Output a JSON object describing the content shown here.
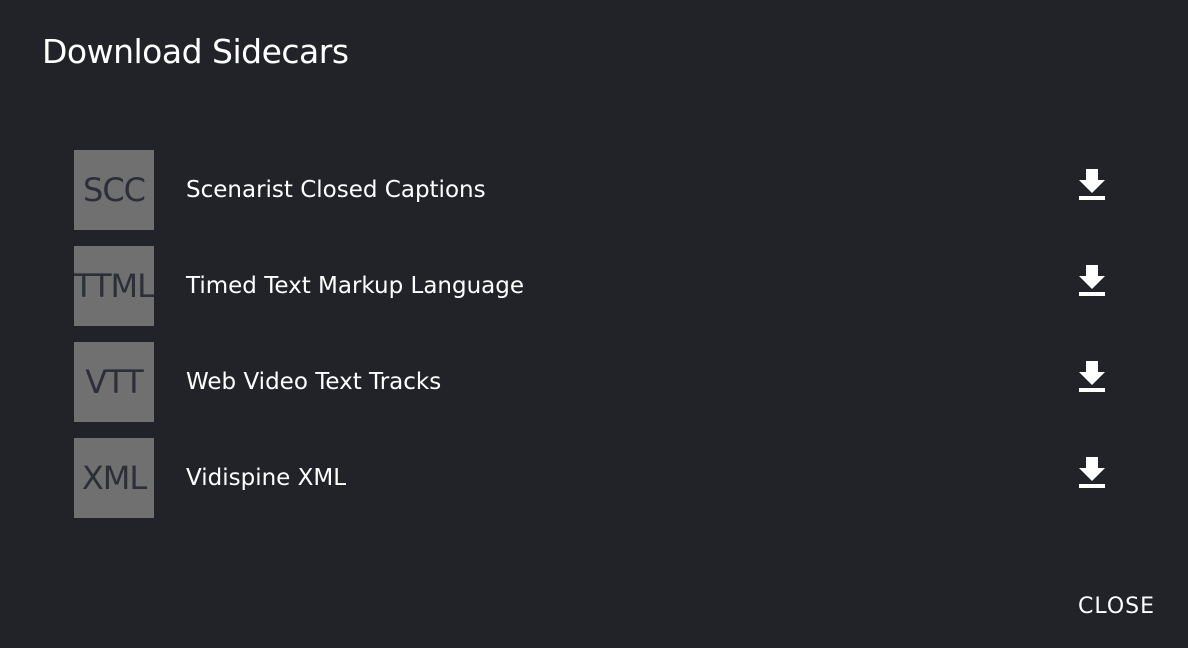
{
  "dialog": {
    "title": "Download Sidecars",
    "close_label": "CLOSE"
  },
  "sidecars": [
    {
      "abbr": "SCC",
      "label": "Scenarist Closed Captions",
      "action_icon": "download-icon"
    },
    {
      "abbr": "TTML",
      "label": "Timed Text Markup Language",
      "action_icon": "download-icon"
    },
    {
      "abbr": "VTT",
      "label": "Web Video Text Tracks",
      "action_icon": "download-icon"
    },
    {
      "abbr": "XML",
      "label": "Vidispine XML",
      "action_icon": "download-icon"
    }
  ],
  "colors": {
    "background": "#212329",
    "thumb": "#707070",
    "thumb_text": "#2c2f37",
    "text": "#ffffff"
  }
}
